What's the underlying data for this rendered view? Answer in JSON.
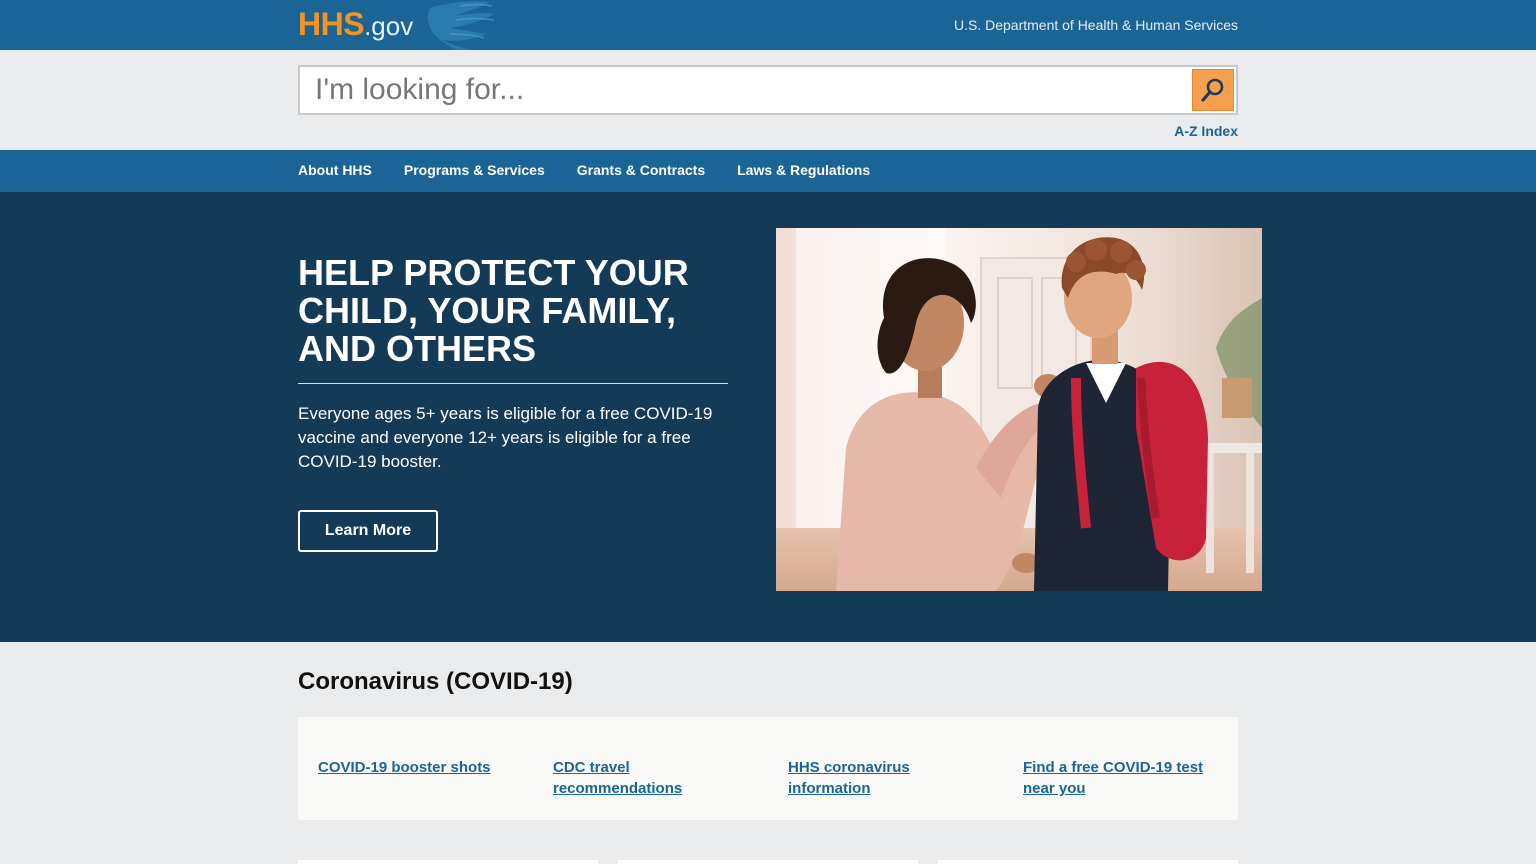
{
  "header": {
    "logo_main": "HHS",
    "logo_suffix": ".gov",
    "department": "U.S. Department of Health & Human Services"
  },
  "search": {
    "placeholder": "I'm looking for...",
    "value": "",
    "button_icon": "search-icon",
    "az_index": "A-Z Index"
  },
  "nav": {
    "items": [
      {
        "label": "About HHS"
      },
      {
        "label": "Programs & Services"
      },
      {
        "label": "Grants & Contracts"
      },
      {
        "label": "Laws & Regulations"
      }
    ]
  },
  "hero": {
    "title": "HELP PROTECT YOUR CHILD, YOUR FAMILY, AND OTHERS",
    "text": "Everyone ages 5+ years is eligible for a free COVID-19 vaccine and everyone 12+ years is eligible for a free COVID-19 booster.",
    "button": "Learn More"
  },
  "covid": {
    "title": "Coronavirus (COVID-19)",
    "links": [
      {
        "label": "COVID-19 booster shots"
      },
      {
        "label": "CDC travel recommendations"
      },
      {
        "label": "HHS coronavirus information"
      },
      {
        "label": "Find a free COVID-19 test near you"
      }
    ]
  },
  "colors": {
    "header_blue": "#1b6596",
    "hero_navy": "#133a57",
    "accent_orange": "#f7931d",
    "page_gray": "#eaebed"
  }
}
